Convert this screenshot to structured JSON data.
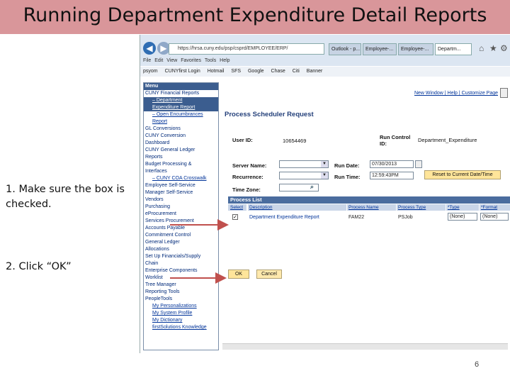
{
  "slide": {
    "title": "Running Department Expenditure Detail Reports",
    "note1": "1. Make sure the box is\nchecked.",
    "note2": "2. Click “OK”",
    "page_number": "6"
  },
  "browser": {
    "address": "https://hrsa.cuny.edu/psp/csprd/EMPLOYEE/ERP/",
    "tabs": [
      "Outlook - p...",
      "Employee-...",
      "Employee-...",
      "Departm..."
    ],
    "menu_items": [
      "File",
      "Edit",
      "View",
      "Favorites",
      "Tools",
      "Help"
    ],
    "favorites": [
      "psyom",
      "CUNYfirst Login",
      "Hotmail",
      "SFS",
      "Google",
      "Chase",
      "Citi",
      "Banner"
    ],
    "icons": [
      "back-icon",
      "forward-icon",
      "home-icon",
      "star-icon",
      "gear-icon"
    ]
  },
  "menu": {
    "title": "Menu",
    "items": [
      {
        "label": "CUNY Financial Reports",
        "sel": false,
        "sub": false
      },
      {
        "label": "– Department",
        "sel": true,
        "sub": true
      },
      {
        "label": "Expenditure Report",
        "sel": true,
        "sub": true
      },
      {
        "label": "– Open Encumbrances",
        "sel": false,
        "sub": true
      },
      {
        "label": "Report",
        "sel": false,
        "sub": true
      },
      {
        "label": "GL Conversions",
        "sel": false,
        "sub": false
      },
      {
        "label": "CUNY Conversion",
        "sel": false,
        "sub": false
      },
      {
        "label": "Dashboard",
        "sel": false,
        "sub": false
      },
      {
        "label": "CUNY General Ledger",
        "sel": false,
        "sub": false
      },
      {
        "label": "Reports",
        "sel": false,
        "sub": false
      },
      {
        "label": "Budget Processing &",
        "sel": false,
        "sub": false
      },
      {
        "label": "Interfaces",
        "sel": false,
        "sub": false
      },
      {
        "label": "– CUNY COA Crosswalk",
        "sel": false,
        "sub": true
      },
      {
        "label": "Employee Self-Service",
        "sel": false,
        "sub": false
      },
      {
        "label": "Manager Self-Service",
        "sel": false,
        "sub": false
      },
      {
        "label": "Vendors",
        "sel": false,
        "sub": false
      },
      {
        "label": "Purchasing",
        "sel": false,
        "sub": false
      },
      {
        "label": "eProcurement",
        "sel": false,
        "sub": false
      },
      {
        "label": "Services Procurement",
        "sel": false,
        "sub": false
      },
      {
        "label": "Accounts Payable",
        "sel": false,
        "sub": false
      },
      {
        "label": "Commitment Control",
        "sel": false,
        "sub": false
      },
      {
        "label": "General Ledger",
        "sel": false,
        "sub": false
      },
      {
        "label": "Allocations",
        "sel": false,
        "sub": false
      },
      {
        "label": "Set Up Financials/Supply",
        "sel": false,
        "sub": false
      },
      {
        "label": "Chain",
        "sel": false,
        "sub": false
      },
      {
        "label": "Enterprise Components",
        "sel": false,
        "sub": false
      },
      {
        "label": "Worklist",
        "sel": false,
        "sub": false
      },
      {
        "label": "Tree Manager",
        "sel": false,
        "sub": false
      },
      {
        "label": "Reporting Tools",
        "sel": false,
        "sub": false
      },
      {
        "label": "PeopleTools",
        "sel": false,
        "sub": false
      },
      {
        "label": "My Personalizations",
        "sel": false,
        "sub": true
      },
      {
        "label": "My System Profile",
        "sel": false,
        "sub": true
      },
      {
        "label": "My Dictionary",
        "sel": false,
        "sub": true
      },
      {
        "label": "firstSolutions Knowledge",
        "sel": false,
        "sub": true
      }
    ]
  },
  "top_links": "New Window | Help | Customize Page",
  "form": {
    "title": "Process Scheduler Request",
    "user_id_label": "User ID:",
    "user_id": "10654469",
    "run_control_label": "Run Control ID:",
    "run_control": "Department_Expenditure",
    "server_label": "Server Name:",
    "recurrence_label": "Recurrence:",
    "timezone_label": "Time Zone:",
    "run_date_label": "Run Date:",
    "run_date": "07/30/2013",
    "run_time_label": "Run Time:",
    "run_time": "12:59:43PM",
    "reset_label": "Reset to Current Date/Time"
  },
  "process_list": {
    "title": "Process List",
    "headers": [
      "Select",
      "Description",
      "Process Name",
      "Process Type",
      "*Type",
      "*Format"
    ],
    "row": {
      "checked": true,
      "description": "Department Expenditure Report",
      "process_name": "FAM22",
      "process_type": "PSJob",
      "type": "(None)",
      "format": "(None)"
    }
  },
  "buttons": {
    "ok": "OK",
    "cancel": "Cancel"
  },
  "colors": {
    "title_band": "#d9969a",
    "arrow": "#c0504d",
    "menu_header": "#3b5d8f"
  }
}
